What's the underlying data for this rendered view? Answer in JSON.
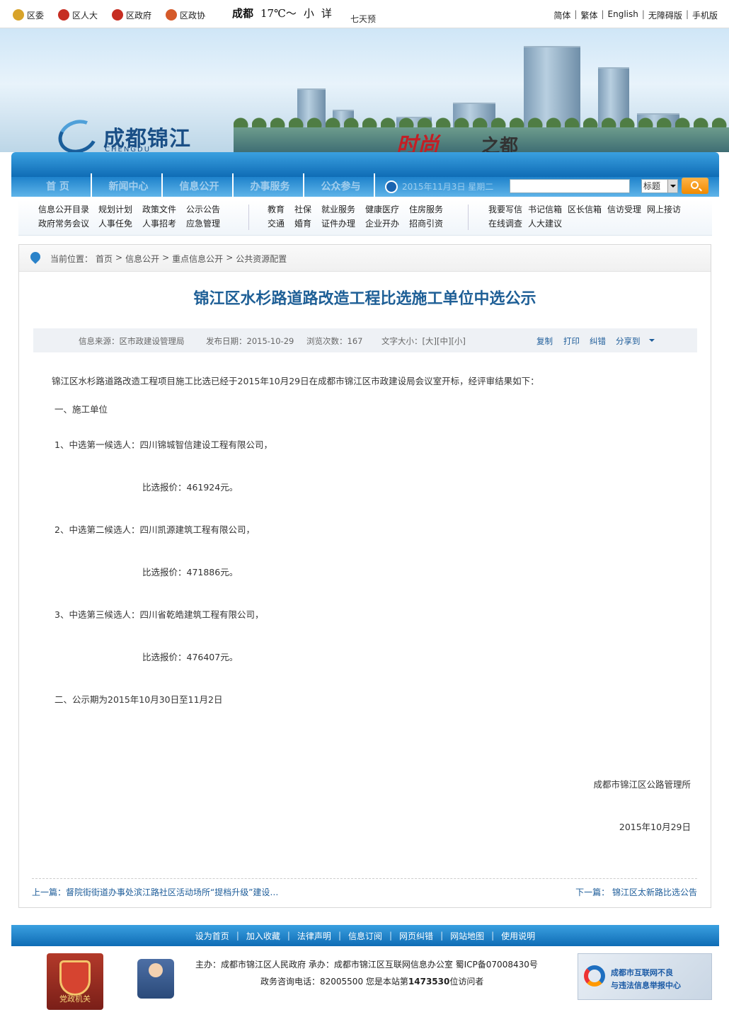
{
  "topbar": {
    "party_links": [
      "区委",
      "区人大",
      "区政府",
      "区政协"
    ],
    "weather_city": "成都",
    "weather_temp": "17℃～",
    "weather_small1": "小",
    "weather_small2": "详",
    "week_report": "七天预报",
    "languages": [
      "简体",
      "繁体",
      "English",
      "无障碍版",
      "手机版"
    ]
  },
  "banner": {
    "logo_name": "成都锦江",
    "logo_pinyin": "CHENGDU JINJIANG",
    "slogan_red": "时尚",
    "slogan_dark": "之都"
  },
  "nav": {
    "items": [
      "首  页",
      "新闻中心",
      "信息公开",
      "办事服务",
      "公众参与"
    ],
    "date_text": "2015年11月3日 星期二",
    "search_placeholder": "",
    "search_scope": "标题"
  },
  "quicklinks": {
    "group1": [
      [
        "信息公开目录",
        "规划计划",
        "政策文件",
        "公示公告"
      ],
      [
        "政府常务会议",
        "人事任免",
        "人事招考",
        "应急管理"
      ]
    ],
    "group2": [
      [
        "教育",
        "社保",
        "就业服务",
        "健康医疗",
        "住房服务"
      ],
      [
        "交通",
        "婚育",
        "证件办理",
        "企业开办",
        "招商引资"
      ]
    ],
    "group3": [
      [
        "我要写信",
        "书记信箱",
        "区长信箱",
        "信访受理",
        "网上接访"
      ],
      [
        "在线调查",
        "人大建议"
      ]
    ]
  },
  "breadcrumb": {
    "label": "当前位置：",
    "items": [
      "首页",
      "信息公开",
      "重点信息公开",
      "公共资源配置"
    ],
    "separator": ">"
  },
  "article": {
    "title": "锦江区水杉路道路改造工程比选施工单位中选公示",
    "source": "信息来源：区市政建设管理局",
    "date": "发布日期：2015-10-29",
    "views": "浏览次数：167",
    "fontsize": "文字大小：[大][中][小]",
    "actions": [
      "复制",
      "打印",
      "纠错",
      "分享到"
    ],
    "paragraphs": [
      "锦江区水杉路道路改造工程项目施工比选已经于2015年10月29日在成都市锦江区市政建设局会议室开标，经评审结果如下：",
      "一、施工单位",
      "1、中选第一候选人：四川锦城智信建设工程有限公司，",
      "比选报价：461924元。",
      "2、中选第二候选人：四川凯源建筑工程有限公司，",
      "比选报价：471886元。",
      "3、中选第三候选人：四川省乾皓建筑工程有限公司，",
      "比选报价：476407元。",
      "二、公示期为2015年10月30日至11月2日",
      "成都市锦江区公路管理所",
      "2015年10月29日"
    ],
    "prev": "上一篇：督院街街道办事处滨江路社区活动场所“提档升级”建设…",
    "next": "下一篇： 锦江区太新路比选公告"
  },
  "footer": {
    "links": [
      "设为首页",
      "加入收藏",
      "法律声明",
      "信息订阅",
      "网页纠错",
      "网站地图",
      "使用说明"
    ],
    "line1": "主办：成都市锦江区人民政府  承办：成都市锦江区互联网信息办公室  蜀ICP备07008430号",
    "line2_prefix": "政务咨询电话：82005500   您是本站第",
    "visitor_count": "1473530",
    "line2_suffix": "位访问者",
    "seal_text": "党政机关",
    "report_line1": "成都市互联网不良",
    "report_line2": "与违法信息举报中心"
  },
  "colors": {
    "nav_blue": "#0f6cb5",
    "title_blue": "#1e5f96",
    "link_blue": "#1d5c99",
    "accent_orange": "#f08a00"
  }
}
